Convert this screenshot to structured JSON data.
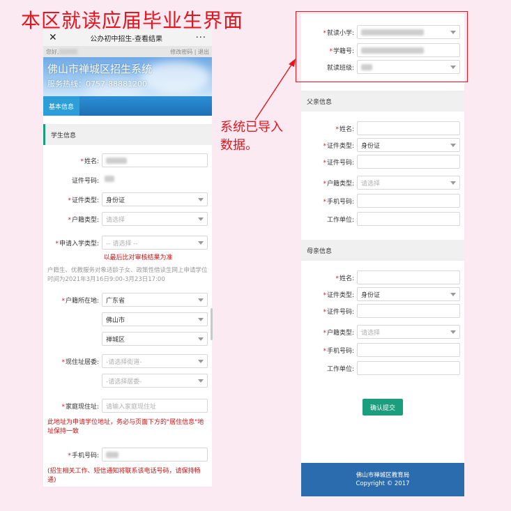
{
  "annotation_title": "本区就读应届毕业生界面",
  "annotation_note": "系统已导入数据。",
  "left": {
    "topbar": {
      "close": "✕",
      "title": "公办初中招生-查看结果",
      "more": "···"
    },
    "userbar": {
      "greeting": "您好,",
      "change_pwd": "修改密码",
      "sep": "|",
      "logout": "退出"
    },
    "banner": {
      "title": "佛山市禅城区招生系统",
      "hotline": "服务热线：0757-88881200"
    },
    "tab": "基本信息",
    "section_title": "学生信息",
    "fields": {
      "name_label": "姓名:",
      "id_no_label": "证件号码:",
      "id_type_label": "证件类型:",
      "id_type_value": "身份证",
      "hukou_type_label": "户籍类型:",
      "hukou_type_placeholder": "请选择",
      "apply_type_label": "申请入学类型:",
      "apply_type_placeholder": "-- 请选择 --",
      "apply_note": "以最后比对审核结果为准",
      "info_note": "户籍生、优教服务对象适龄子女、政策性借读生网上申请学位时间为2021年3月16日9:00-3月23日17:00",
      "hukou_loc_label": "户籍所在地:",
      "province": "广东省",
      "city": "佛山市",
      "district": "禅城区",
      "residence_label": "现住址居委:",
      "street_placeholder": "-请选择街道-",
      "committee_placeholder": "-请选择居委-",
      "address_label": "家庭现住址:",
      "address_placeholder": "请输入家庭现住址",
      "address_note": "此地址为申请学位地址，务必与页面下方的\"居住信息\"地址保持一致",
      "phone_label": "手机号码:",
      "phone_note": "(招生相关工作、短信通知将联系该电话号码，请保持畅通)"
    }
  },
  "right": {
    "school": {
      "primary_label": "就读小学:",
      "student_no_label": "学籍号:",
      "class_label": "就读班级:"
    },
    "father": {
      "title": "父亲信息",
      "name_label": "姓名:",
      "id_type_label": "证件类型:",
      "id_type_value": "身份证",
      "id_no_label": "证件号码:",
      "hukou_type_label": "户籍类型:",
      "hukou_type_placeholder": "请选择",
      "phone_label": "手机号码:",
      "work_label": "工作单位:"
    },
    "mother": {
      "title": "母亲信息",
      "name_label": "姓名:",
      "id_type_label": "证件类型:",
      "id_type_value": "身份证",
      "id_no_label": "证件号码:",
      "hukou_type_label": "户籍类型:",
      "hukou_type_placeholder": "请选择",
      "phone_label": "手机号码:",
      "work_label": "工作单位:"
    },
    "submit": "确认提交",
    "footer": {
      "org": "佛山市禅城区教育局",
      "copyright": "Copyright © 2017"
    }
  },
  "colors": {
    "accent_red": "#e8141c",
    "brand_green": "#1a9e7e",
    "footer_blue": "#2a6cae",
    "tab_blue": "#2d9ed8"
  }
}
